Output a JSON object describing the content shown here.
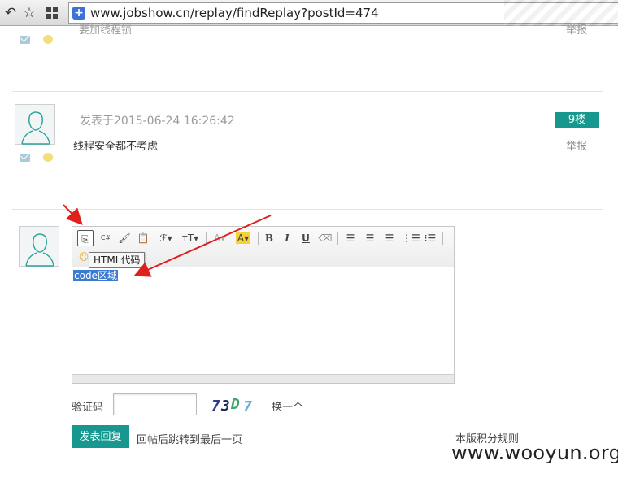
{
  "browser": {
    "url": "www.jobshow.cn/replay/findReplay?postId=474",
    "back_icon": "undo-icon",
    "star_icon": "star-icon",
    "grid_icon": "grid-icon",
    "site_icon": "plus-shield-icon"
  },
  "previous_post": {
    "faded_text": "要加线程锁",
    "report": "举报"
  },
  "post": {
    "time": "发表于2015-06-24 16:26:42",
    "floor": "9楼",
    "body": "线程安全都不考虑",
    "report": "举报"
  },
  "editor": {
    "toolbar": [
      {
        "name": "html-code-icon",
        "glyph": "⎘"
      },
      {
        "name": "csharp-icon",
        "glyph": "C#"
      },
      {
        "name": "format-brush-icon",
        "glyph": "🖌"
      },
      {
        "name": "paste-icon",
        "glyph": "📋"
      },
      {
        "name": "font-family-icon",
        "glyph": "ℱ▾"
      },
      {
        "name": "font-size-icon",
        "glyph": "ᴛT▾"
      },
      {
        "name": "font-color-icon",
        "glyph": "A▾"
      },
      {
        "name": "highlight-icon",
        "glyph": "A▾"
      },
      {
        "name": "bold-icon",
        "glyph": "B"
      },
      {
        "name": "italic-icon",
        "glyph": "I"
      },
      {
        "name": "underline-icon",
        "glyph": "U"
      },
      {
        "name": "eraser-icon",
        "glyph": "⌫"
      },
      {
        "name": "align-left-icon",
        "glyph": "☰"
      },
      {
        "name": "align-center-icon",
        "glyph": "☰"
      },
      {
        "name": "align-right-icon",
        "glyph": "☰"
      },
      {
        "name": "ordered-list-icon",
        "glyph": "⋮☰"
      },
      {
        "name": "bullet-list-icon",
        "glyph": "⁝☰"
      },
      {
        "name": "emoji-icon",
        "glyph": "☺"
      }
    ],
    "tooltip": "HTML代码",
    "content": "code区域"
  },
  "captcha": {
    "label": "验证码",
    "value": "",
    "chars": [
      "7",
      "3",
      "D",
      "7"
    ],
    "refresh": "换一个"
  },
  "actions": {
    "submit": "发表回复",
    "jump_note": "回帖后跳转到最后一页",
    "rules": "本版积分规则"
  },
  "watermark": "www.wooyun.org",
  "colors": {
    "accent": "#17988f",
    "selection": "#3b7bd4",
    "arrow": "#e0201c"
  }
}
